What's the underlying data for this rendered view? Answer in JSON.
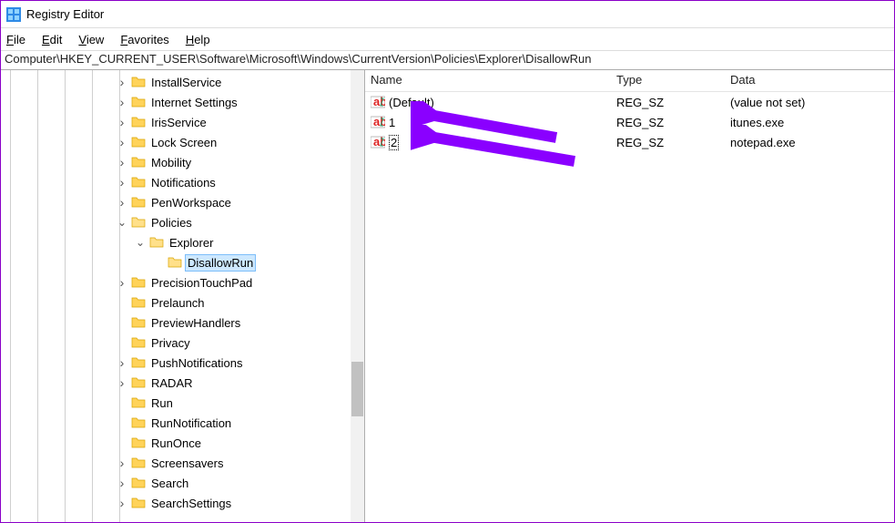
{
  "window": {
    "title": "Registry Editor"
  },
  "menu": {
    "file": {
      "u": "F",
      "rest": "ile"
    },
    "edit": {
      "u": "E",
      "rest": "dit"
    },
    "view": {
      "u": "V",
      "rest": "iew"
    },
    "favorites": {
      "u": "F",
      "rest": "avorites"
    },
    "help": {
      "u": "H",
      "rest": "elp"
    }
  },
  "address": "Computer\\HKEY_CURRENT_USER\\Software\\Microsoft\\Windows\\CurrentVersion\\Policies\\Explorer\\DisallowRun",
  "tree": [
    {
      "indent": 125,
      "exp": "closed",
      "label": "InstallService"
    },
    {
      "indent": 125,
      "exp": "closed",
      "label": "Internet Settings"
    },
    {
      "indent": 125,
      "exp": "closed",
      "label": "IrisService"
    },
    {
      "indent": 125,
      "exp": "closed",
      "label": "Lock Screen"
    },
    {
      "indent": 125,
      "exp": "closed",
      "label": "Mobility"
    },
    {
      "indent": 125,
      "exp": "closed",
      "label": "Notifications"
    },
    {
      "indent": 125,
      "exp": "closed",
      "label": "PenWorkspace"
    },
    {
      "indent": 125,
      "exp": "open",
      "label": "Policies"
    },
    {
      "indent": 145,
      "exp": "open",
      "label": "Explorer"
    },
    {
      "indent": 165,
      "exp": "none",
      "label": "DisallowRun",
      "selected": true
    },
    {
      "indent": 125,
      "exp": "closed",
      "label": "PrecisionTouchPad"
    },
    {
      "indent": 125,
      "exp": "none",
      "label": "Prelaunch"
    },
    {
      "indent": 125,
      "exp": "none",
      "label": "PreviewHandlers"
    },
    {
      "indent": 125,
      "exp": "none",
      "label": "Privacy"
    },
    {
      "indent": 125,
      "exp": "closed",
      "label": "PushNotifications"
    },
    {
      "indent": 125,
      "exp": "closed",
      "label": "RADAR"
    },
    {
      "indent": 125,
      "exp": "none",
      "label": "Run"
    },
    {
      "indent": 125,
      "exp": "none",
      "label": "RunNotification"
    },
    {
      "indent": 125,
      "exp": "none",
      "label": "RunOnce"
    },
    {
      "indent": 125,
      "exp": "closed",
      "label": "Screensavers"
    },
    {
      "indent": 125,
      "exp": "closed",
      "label": "Search"
    },
    {
      "indent": 125,
      "exp": "closed",
      "label": "SearchSettings"
    }
  ],
  "list": {
    "headers": {
      "name": "Name",
      "type": "Type",
      "data": "Data"
    },
    "rows": [
      {
        "name": "(Default)",
        "type": "REG_SZ",
        "data": "(value not set)"
      },
      {
        "name": "1",
        "type": "REG_SZ",
        "data": "itunes.exe"
      },
      {
        "name": "2",
        "type": "REG_SZ",
        "data": "notepad.exe",
        "editing": true
      }
    ]
  }
}
